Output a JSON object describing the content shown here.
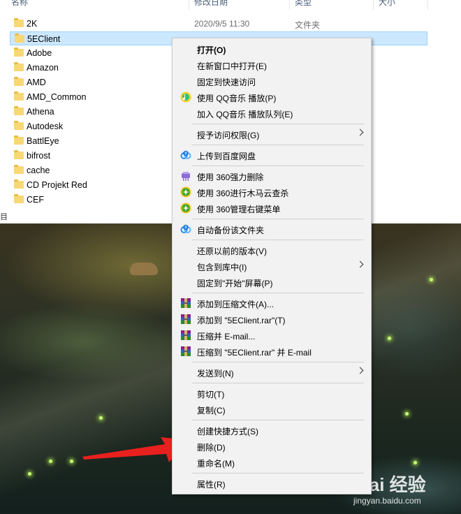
{
  "explorer": {
    "columns": {
      "name": "名称",
      "date": "修改日期",
      "type": "类型",
      "size": "大小"
    },
    "files": [
      {
        "name": "2K",
        "date": "2020/9/5 11:30",
        "type": "文件夹"
      },
      {
        "name": "5EClient",
        "date": "",
        "type": "",
        "selected": true
      },
      {
        "name": "Adobe",
        "date": "",
        "type": ""
      },
      {
        "name": "Amazon",
        "date": "",
        "type": ""
      },
      {
        "name": "AMD",
        "date": "",
        "type": ""
      },
      {
        "name": "AMD_Common",
        "date": "",
        "type": ""
      },
      {
        "name": "Athena",
        "date": "",
        "type": ""
      },
      {
        "name": "Autodesk",
        "date": "",
        "type": ""
      },
      {
        "name": "BattlEye",
        "date": "",
        "type": ""
      },
      {
        "name": "bifrost",
        "date": "",
        "type": ""
      },
      {
        "name": "cache",
        "date": "",
        "type": ""
      },
      {
        "name": "CD Projekt Red",
        "date": "",
        "type": ""
      },
      {
        "name": "CEF",
        "date": "",
        "type": ""
      }
    ],
    "status_fragment": "目"
  },
  "context_menu": {
    "items": [
      {
        "label": "打开(O)",
        "bold": true,
        "icon": ""
      },
      {
        "label": "在新窗口中打开(E)",
        "icon": ""
      },
      {
        "label": "固定到快速访问",
        "icon": ""
      },
      {
        "label": "使用 QQ音乐 播放(P)",
        "icon": "qq-music-icon"
      },
      {
        "label": "加入 QQ音乐 播放队列(E)",
        "icon": ""
      },
      {
        "label": "授予访问权限(G)",
        "icon": "",
        "submenu": true
      },
      {
        "label": "上传到百度网盘",
        "icon": "baidu-netdisk-icon"
      },
      {
        "label": "使用 360强力删除",
        "icon": "360-shred-icon"
      },
      {
        "label": "使用 360进行木马云查杀",
        "icon": "360-scan-icon"
      },
      {
        "label": "使用 360管理右键菜单",
        "icon": "360-menu-icon"
      },
      {
        "label": "自动备份该文件夹",
        "icon": "baidu-backup-icon"
      },
      {
        "label": "还原以前的版本(V)",
        "icon": ""
      },
      {
        "label": "包含到库中(I)",
        "icon": "",
        "submenu": true
      },
      {
        "label": "固定到\"开始\"屏幕(P)",
        "icon": ""
      },
      {
        "label": "添加到压缩文件(A)...",
        "icon": "winrar-icon"
      },
      {
        "label": "添加到 \"5EClient.rar\"(T)",
        "icon": "winrar-icon"
      },
      {
        "label": "压缩并 E-mail...",
        "icon": "winrar-icon"
      },
      {
        "label": "压缩到 \"5EClient.rar\" 并 E-mail",
        "icon": "winrar-icon"
      },
      {
        "label": "发送到(N)",
        "icon": "",
        "submenu": true
      },
      {
        "label": "剪切(T)",
        "icon": ""
      },
      {
        "label": "复制(C)",
        "icon": ""
      },
      {
        "label": "创建快捷方式(S)",
        "icon": ""
      },
      {
        "label": "删除(D)",
        "icon": ""
      },
      {
        "label": "重命名(M)",
        "icon": ""
      },
      {
        "label": "属性(R)",
        "icon": ""
      }
    ]
  },
  "annotation": {
    "arrow_color": "#e8201e",
    "target": "删除(D)"
  },
  "watermark": {
    "logo": "Bai 经验",
    "url": "jingyan.baidu.com"
  },
  "colors": {
    "selection": "#cce8ff",
    "menu_bg": "#f2f2f2",
    "folder": "#f8d775"
  }
}
